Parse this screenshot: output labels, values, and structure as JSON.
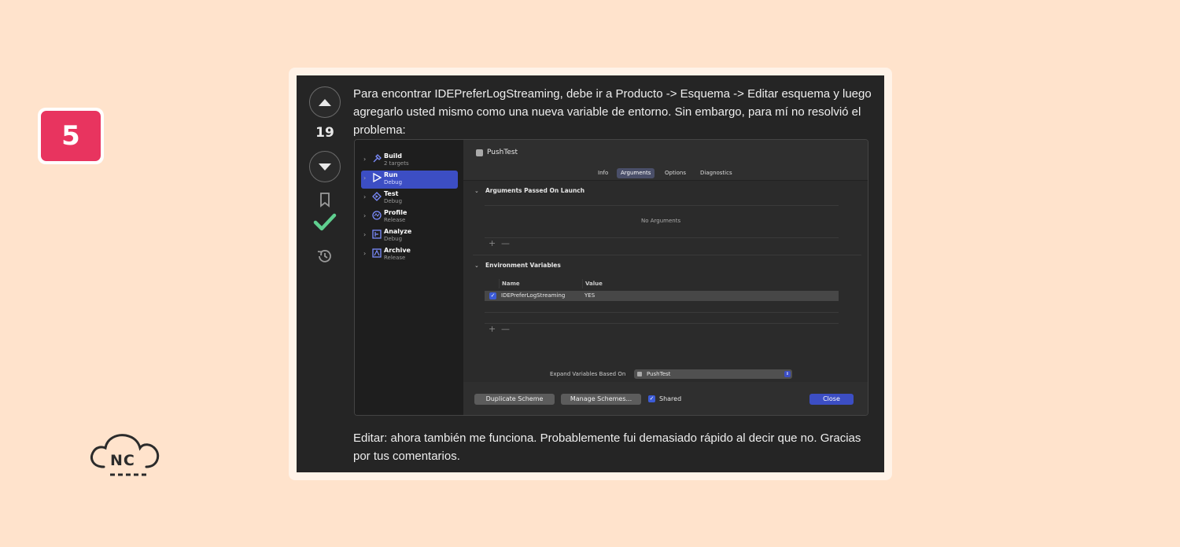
{
  "badge": {
    "number": "5"
  },
  "logo": {
    "text": "NC"
  },
  "votes": {
    "count": "19"
  },
  "post": {
    "paragraph1": "Para encontrar IDEPreferLogStreaming, debe ir a Producto -> Esquema -> Editar esquema y luego agregarlo usted mismo como una nueva variable de entorno. Sin embargo, para mí no resolvió el problema:",
    "paragraph2": "Editar: ahora también me funciona. Probablemente fui demasiado rápido al decir que no. Gracias por tus comentarios."
  },
  "screenshot": {
    "sidebar": [
      {
        "title": "Build",
        "subtitle": "2 targets",
        "icon": "hammer-icon",
        "selected": false
      },
      {
        "title": "Run",
        "subtitle": "Debug",
        "icon": "play-icon",
        "selected": true
      },
      {
        "title": "Test",
        "subtitle": "Debug",
        "icon": "diamond-icon",
        "selected": false
      },
      {
        "title": "Profile",
        "subtitle": "Release",
        "icon": "gauge-icon",
        "selected": false
      },
      {
        "title": "Analyze",
        "subtitle": "Debug",
        "icon": "analyze-icon",
        "selected": false
      },
      {
        "title": "Archive",
        "subtitle": "Release",
        "icon": "archive-icon",
        "selected": false
      }
    ],
    "title": "PushTest",
    "tabs": [
      "Info",
      "Arguments",
      "Options",
      "Diagnostics"
    ],
    "selected_tab": "Arguments",
    "args_section": "Arguments Passed On Launch",
    "no_args": "No Arguments",
    "plus": "+",
    "minus": "—",
    "env_section": "Environment Variables",
    "col_name": "Name",
    "col_value": "Value",
    "env_row": {
      "name": "IDEPreferLogStreaming",
      "value": "YES",
      "checked": true
    },
    "expand_label": "Expand Variables Based On",
    "expand_value": "PushTest",
    "buttons": {
      "duplicate": "Duplicate Scheme",
      "manage": "Manage Schemes...",
      "shared": "Shared",
      "close": "Close"
    },
    "accent_color": "#3c4ec4"
  }
}
